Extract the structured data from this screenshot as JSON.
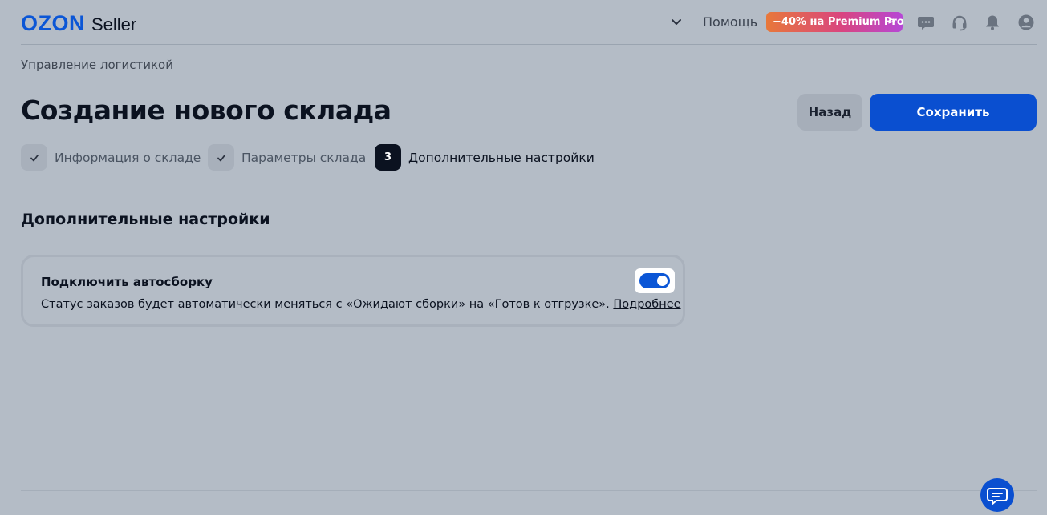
{
  "header": {
    "logo_brand": "OZON",
    "logo_product": "Seller",
    "help_label": "Помощь",
    "promo_label": "−40% на Premium Pro",
    "promo_arrow": ">",
    "icons": [
      "chevron-down-icon",
      "chat-icon",
      "headset-icon",
      "bell-icon",
      "user-icon"
    ]
  },
  "breadcrumb": "Управление логистикой",
  "page_title": "Создание нового склада",
  "actions": {
    "back_label": "Назад",
    "save_label": "Сохранить"
  },
  "steps": [
    {
      "label": "Информация о складе",
      "state": "done"
    },
    {
      "label": "Параметры склада",
      "state": "done"
    },
    {
      "number": "3",
      "label": "Дополнительные настройки",
      "state": "active"
    }
  ],
  "section_title": "Дополнительные настройки",
  "autobuild": {
    "title": "Подключить автосборку",
    "description": "Статус заказов будет автоматически меняться с «Ожидают сборки» на «Готов к отгрузке». ",
    "link": "Подробнее",
    "enabled": true
  },
  "colors": {
    "accent": "#0b56d6",
    "background": "#b4bcc6"
  }
}
